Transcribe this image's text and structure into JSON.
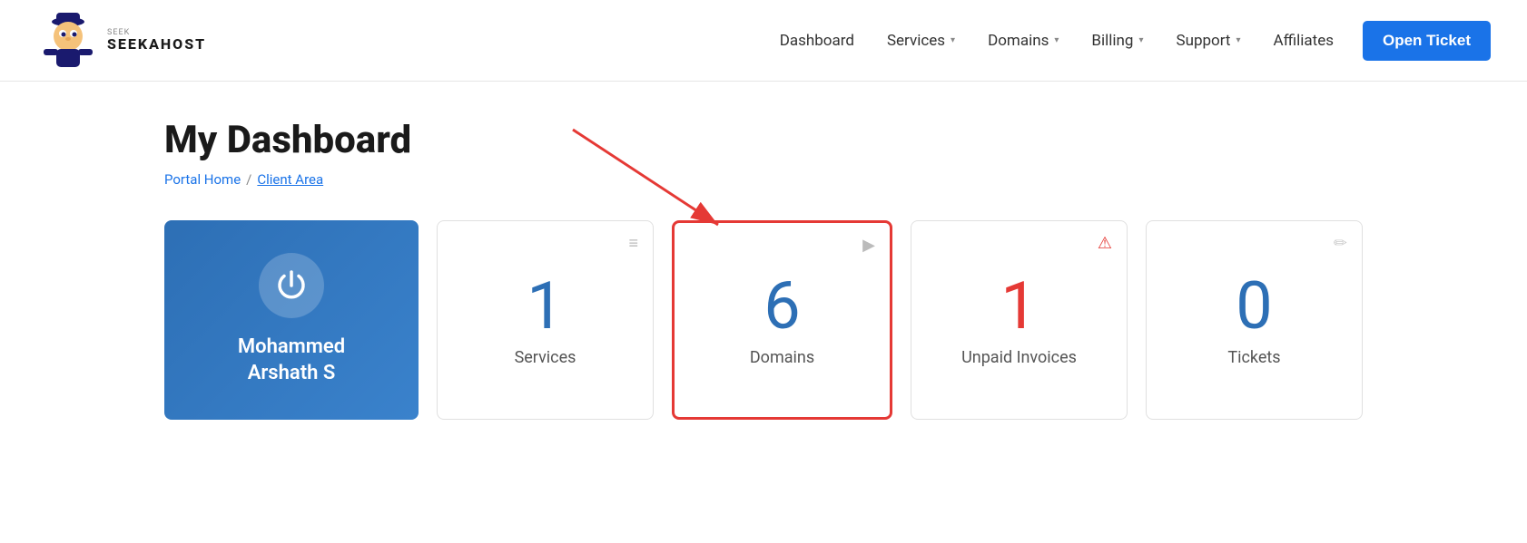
{
  "header": {
    "logo_text": "SEEKAHOST",
    "nav": [
      {
        "label": "Dashboard",
        "has_dropdown": false,
        "id": "dashboard"
      },
      {
        "label": "Services",
        "has_dropdown": true,
        "id": "services"
      },
      {
        "label": "Domains",
        "has_dropdown": true,
        "id": "domains"
      },
      {
        "label": "Billing",
        "has_dropdown": true,
        "id": "billing"
      },
      {
        "label": "Support",
        "has_dropdown": true,
        "id": "support"
      },
      {
        "label": "Affiliates",
        "has_dropdown": false,
        "id": "affiliates"
      }
    ],
    "open_ticket_label": "Open Ticket"
  },
  "page": {
    "title": "My Dashboard",
    "breadcrumb": {
      "home": "Portal Home",
      "separator": "/",
      "current": "Client Area"
    }
  },
  "user_card": {
    "name_line1": "Mohammed",
    "name_line2": "Arshath S"
  },
  "stats": [
    {
      "id": "services",
      "value": "1",
      "label": "Services",
      "icon": "≡",
      "highlighted": false,
      "icon_class": ""
    },
    {
      "id": "domains",
      "value": "6",
      "label": "Domains",
      "icon": "▷",
      "highlighted": true,
      "icon_class": ""
    },
    {
      "id": "unpaid-invoices",
      "value": "1",
      "label": "Unpaid Invoices",
      "icon": "!",
      "highlighted": false,
      "icon_class": "red",
      "value_class": "red"
    },
    {
      "id": "tickets",
      "value": "0",
      "label": "Tickets",
      "icon": "✏",
      "highlighted": false,
      "icon_class": ""
    }
  ]
}
